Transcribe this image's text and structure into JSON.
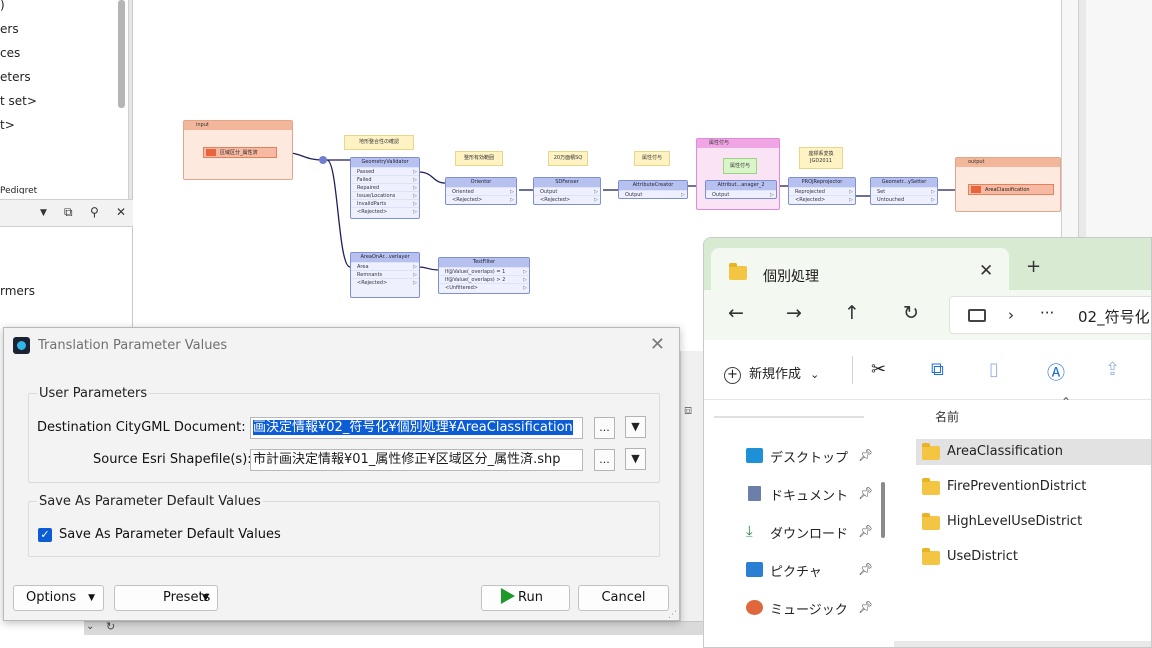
{
  "navigator": {
    "items": [
      ")",
      "ers",
      "ces",
      "eters",
      "t set>",
      "t>",
      "Pedigret"
    ],
    "transformers_label": "rmers"
  },
  "workspace": {
    "input_bookmark": "input",
    "output_bookmark": "output",
    "pink_bookmark": "属性付与",
    "reader_label": "区域区分_属性済",
    "writer_label": "AreaClassification",
    "notes": [
      "地形整合性の確認",
      "整形有効範囲",
      "20万面積SQ",
      "属性付与",
      "座標系変換 JGD2011",
      "属性付与"
    ],
    "transformers": [
      {
        "name": "GeometryValidator",
        "ports": [
          "Passed",
          "Failed",
          "Repaired",
          "Issue/Locations",
          "InvalidParts",
          "<Rejected>"
        ]
      },
      {
        "name": "Orientor",
        "ports": [
          "Oriented",
          "<Rejected>"
        ]
      },
      {
        "name": "SDFenser",
        "ports": [
          "Output",
          "<Rejected>"
        ]
      },
      {
        "name": "AttributeCreator",
        "ports": [
          "Output"
        ]
      },
      {
        "name": "Attribut...anager_2",
        "ports": [
          "Output"
        ]
      },
      {
        "name": "PROJReprojector",
        "ports": [
          "Reprojected",
          "<Rejected>"
        ]
      },
      {
        "name": "Geometr...ySetter",
        "ports": [
          "Set",
          "Untouched"
        ]
      },
      {
        "name": "AreaOnAr...verlayer",
        "ports": [
          "Area",
          "Remnants",
          "<Rejected>"
        ]
      },
      {
        "name": "TestFilter",
        "ports": [
          "If@Value(_overlaps) = 1",
          "If@Value(_overlaps) > 2",
          "<Unfiltered>"
        ]
      }
    ]
  },
  "dialog": {
    "title": "Translation Parameter Values",
    "user_params_group": "User Parameters",
    "dest_label": "Destination CityGML Document:",
    "dest_value": "画決定情報¥02_符号化¥個別処理¥AreaClassification",
    "src_label": "Source Esri Shapefile(s):",
    "src_value": "市計画決定情報¥01_属性修正¥区域区分_属性済.shp",
    "browse_label": "...",
    "dropdown_glyph": "▼",
    "save_group": "Save As Parameter Default Values",
    "save_checkbox_label": "Save As Parameter Default Values",
    "save_checked": true,
    "options_label": "Options",
    "presets_label": "Presets",
    "run_label": "Run",
    "cancel_label": "Cancel",
    "close_glyph": "✕"
  },
  "explorer": {
    "tab_title": "個別処理",
    "close_glyph": "✕",
    "new_tab_glyph": "+",
    "nav": {
      "back": "←",
      "forward": "→",
      "up": "↑",
      "refresh": "↻"
    },
    "address": {
      "chevron": "›",
      "ellipsis": "···",
      "crumb": "02_符号化"
    },
    "new_button": "新規作成",
    "new_caret": "⌄",
    "column_header": "名前",
    "sidebar": [
      {
        "label": "デスクトップ",
        "icon": "desktop-icon",
        "color": "#1e90d8"
      },
      {
        "label": "ドキュメント",
        "icon": "document-icon",
        "color": "#6b7fa8"
      },
      {
        "label": "ダウンロード",
        "icon": "download-icon",
        "color": "#2e8b57"
      },
      {
        "label": "ピクチャ",
        "icon": "picture-icon",
        "color": "#2a7fd4"
      },
      {
        "label": "ミュージック",
        "icon": "music-icon",
        "color": "#e0663c"
      }
    ],
    "folders": [
      {
        "name": "AreaClassification",
        "selected": true
      },
      {
        "name": "FirePreventionDistrict",
        "selected": false
      },
      {
        "name": "HighLevelUseDistrict",
        "selected": false
      },
      {
        "name": "UseDistrict",
        "selected": false
      }
    ]
  },
  "colors": {
    "accent": "#0b5cd5",
    "run_green": "#1f9a2a",
    "explorer_tab_bg": "#d9ead3",
    "folder": "#f4c542"
  }
}
